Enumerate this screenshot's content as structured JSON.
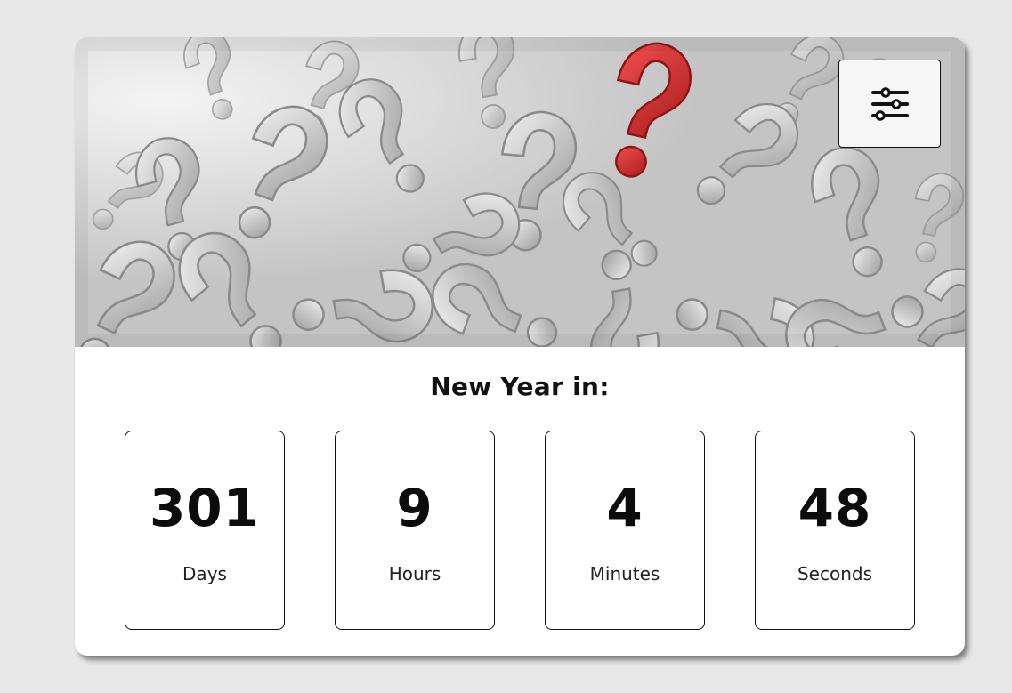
{
  "countdown": {
    "title": "New Year in:",
    "units": [
      {
        "value": "301",
        "label": "Days"
      },
      {
        "value": "9",
        "label": "Hours"
      },
      {
        "value": "4",
        "label": "Minutes"
      },
      {
        "value": "48",
        "label": "Seconds"
      }
    ]
  },
  "hero": {
    "image_subject": "question-marks-image",
    "accent_color": "#e03a3a"
  },
  "settings": {
    "icon": "sliders-icon"
  },
  "colors": {
    "page_background": "#e8e8e8",
    "card_background": "#ffffff",
    "text": "#111111"
  }
}
